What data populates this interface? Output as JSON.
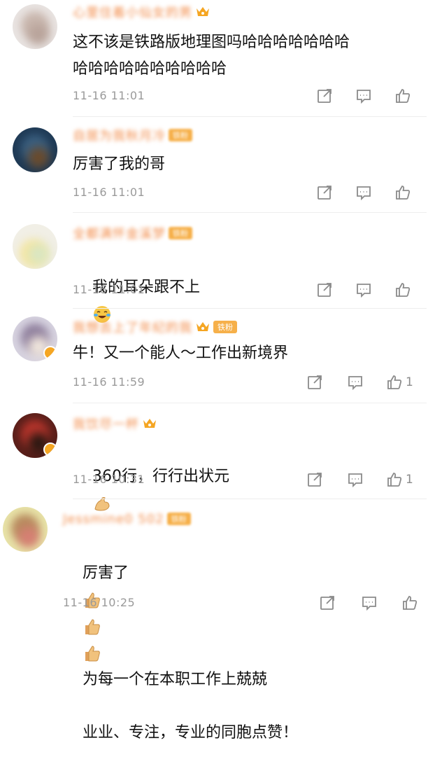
{
  "comments": [
    {
      "username": "心里住着小仙女的男",
      "has_crown": true,
      "tag": "",
      "text": "这不该是铁路版地理图吗哈哈哈哈哈哈哈\n哈哈哈哈哈哈哈哈哈哈",
      "time": "11-16 11:01",
      "like_count": ""
    },
    {
      "username": "自居为我秋月冷",
      "has_crown": false,
      "tag": "铁粉",
      "text": "厉害了我的哥",
      "time": "11-16 11:01",
      "like_count": ""
    },
    {
      "username": "全都满怀金溪梦",
      "has_crown": false,
      "tag": "铁粉",
      "text": "我的耳朵跟不上",
      "emoji": "laugh-cry-emoji",
      "time": "11-16 11:01",
      "like_count": ""
    },
    {
      "username": "我想去上了年纪的我",
      "has_crown": true,
      "tag": "铁粉",
      "text": "牛！又一个能人～工作出新境界",
      "time": "11-16 11:59",
      "like_count": "1"
    },
    {
      "username": "我饮尽一杯",
      "has_crown": true,
      "tag": "",
      "text": "360行，行行出状元",
      "emoji": "flexed-biceps-emoji",
      "time": "11-16 10:31",
      "like_count": "1"
    },
    {
      "username": "Jessmine0 502",
      "has_crown": false,
      "tag": "铁粉",
      "text_part1": "厉害了",
      "text_part2": "为每一个在本职工作上兢兢",
      "text_line2": "业业、专注，专业的同胞点赞！",
      "time": "11-16 10:25",
      "like_count": ""
    }
  ],
  "colors": {
    "username": "#f28c4a",
    "time": "#9a9a9a",
    "icon": "#8b8b8b",
    "badge": "#f6b04a"
  }
}
